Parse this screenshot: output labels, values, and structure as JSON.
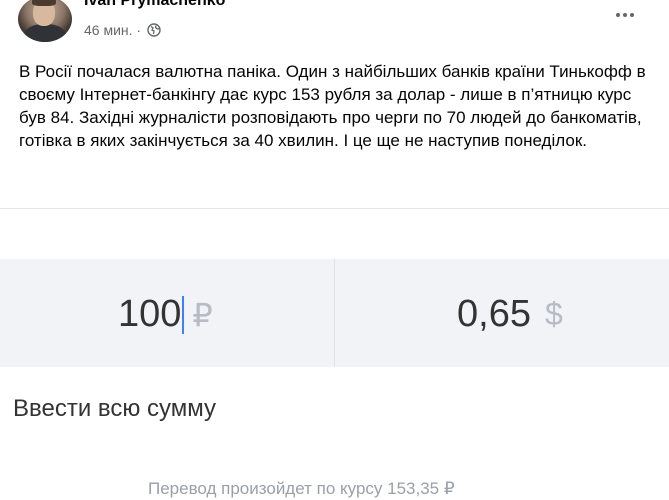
{
  "post": {
    "author": "Ivan Prymachenko",
    "time": "46 мин. ·",
    "text": "В Росії почалася валютна паніка. Один з найбільших банків країни Тинькофф в своєму Інтернет-банкінгу дає курс 153 рубля за долар - лише в п’ятницю курс був 84. Західні журналісти розповідають про черги по 70 людей до банкоматів, готівка в яких закінчується за 40 хвилин. І це ще не наступив понеділок."
  },
  "icons": {
    "globe": "globe-icon",
    "more": "more-horizontal-icon"
  },
  "converter": {
    "from_amount": "100",
    "from_currency": "₽",
    "to_amount": "0,65",
    "to_currency": "$",
    "enter_all_label": "Ввести всю сумму",
    "rate_note": "Перевод произойдет по курсу 153,35 ₽"
  },
  "colors": {
    "cursor": "#3b82f6",
    "converter_bg": "#f1f3f7",
    "muted_text": "#9aa0a8"
  }
}
